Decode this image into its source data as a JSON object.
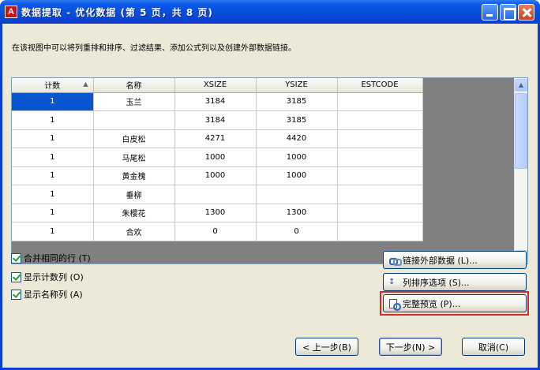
{
  "window": {
    "title": "数据提取 - 优化数据 (第 5 页，共 8 页)",
    "app_icon_letter": "A"
  },
  "instruction": "在该视图中可以将列重排和排序、过滤结果、添加公式列以及创建外部数据链接。",
  "table": {
    "columns": [
      "计数",
      "名称",
      "XSIZE",
      "YSIZE",
      "ESTCODE"
    ],
    "rows": [
      [
        "1",
        "玉兰",
        "3184",
        "3185",
        ""
      ],
      [
        "1",
        "",
        "3184",
        "3185",
        ""
      ],
      [
        "1",
        "白皮松",
        "4271",
        "4420",
        ""
      ],
      [
        "1",
        "马尾松",
        "1000",
        "1000",
        ""
      ],
      [
        "1",
        "黄金槐",
        "1000",
        "1000",
        ""
      ],
      [
        "1",
        "垂柳",
        "",
        "",
        ""
      ],
      [
        "1",
        "朱樱花",
        "1300",
        "1300",
        ""
      ],
      [
        "1",
        "合欢",
        "0",
        "0",
        ""
      ]
    ],
    "sort_indicator": "sort-ascending-icon"
  },
  "options": {
    "merge_rows": {
      "label": "合并相同的行 (T)",
      "checked": true
    },
    "show_count": {
      "label": "显示计数列 (O)",
      "checked": true
    },
    "show_name": {
      "label": "显示名称列 (A)",
      "checked": true
    }
  },
  "side_buttons": {
    "link_external": "链接外部数据 (L)...",
    "sort_options": "列排序选项 (S)...",
    "full_preview": "完整预览 (P)..."
  },
  "nav_buttons": {
    "back": "< 上一步(B)",
    "next": "下一步(N) >",
    "cancel": "取消(C)"
  },
  "colors": {
    "title_bar": "#0a58e8",
    "dialog_bg": "#ece9d8",
    "selected_cell": "#0a56d0",
    "highlight_border": "#d42a2a"
  }
}
